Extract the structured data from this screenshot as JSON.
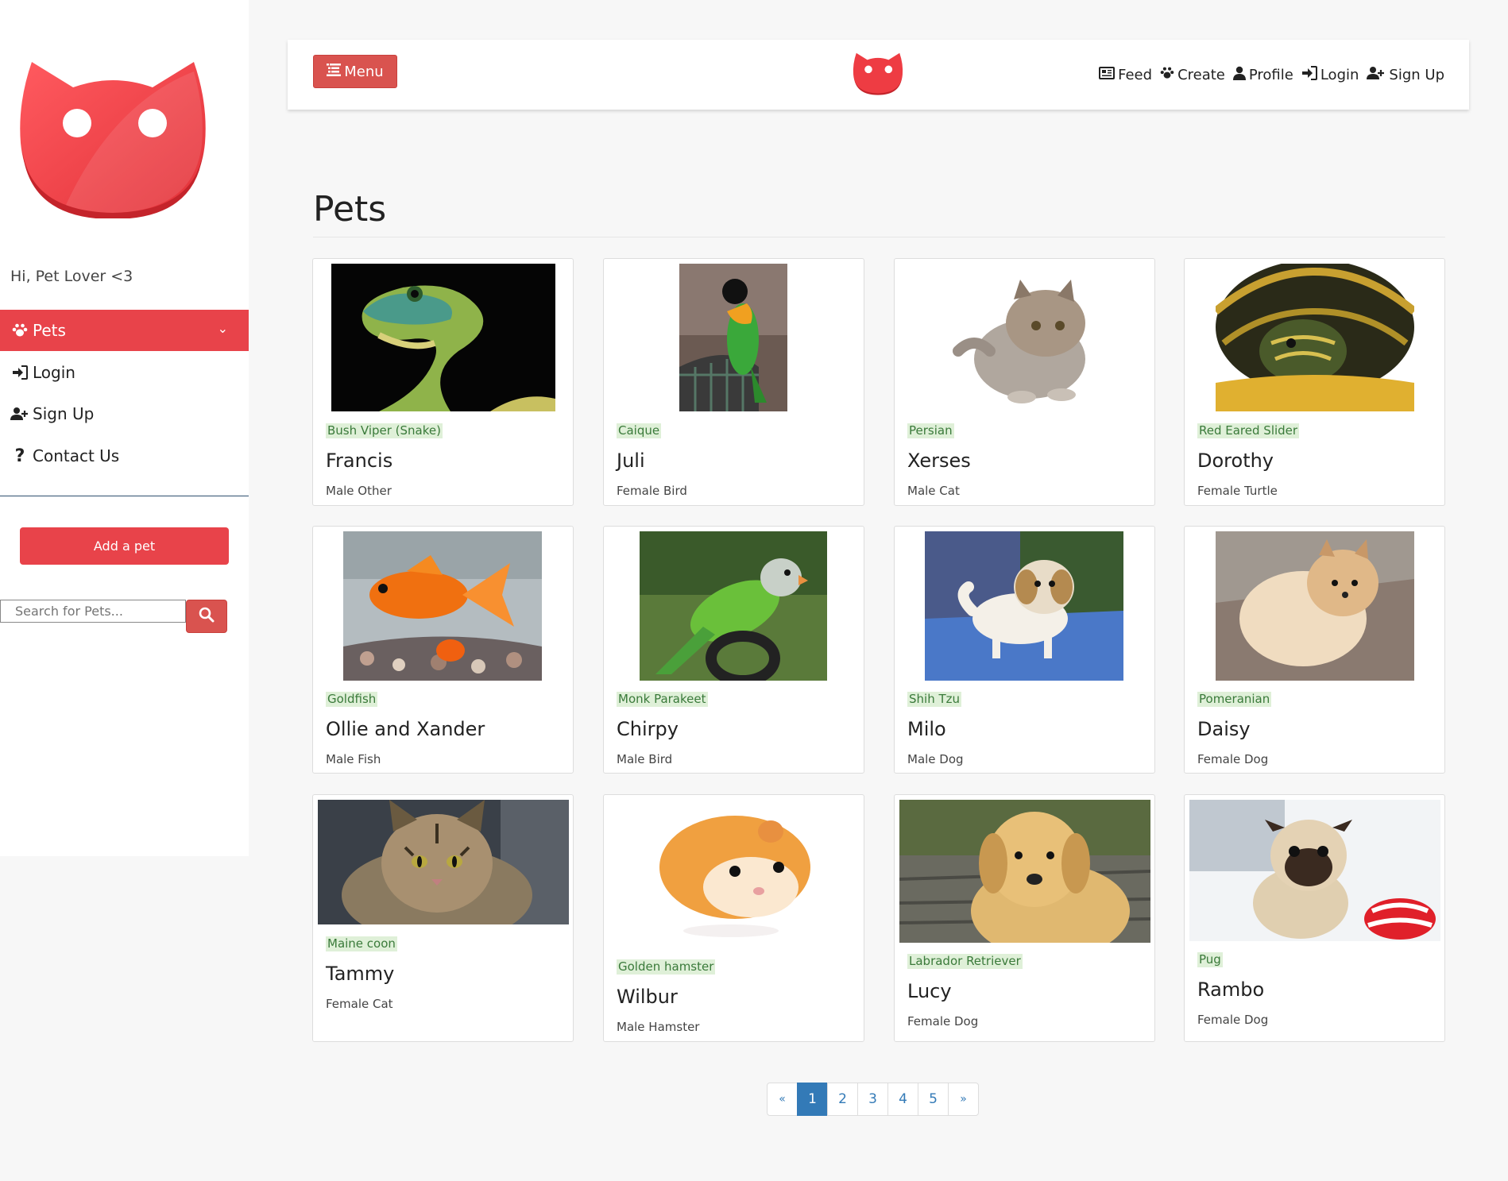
{
  "brand_color": "#e8434a",
  "sidebar": {
    "greeting": "Hi, Pet Lover <3",
    "nav": [
      {
        "label": "Pets",
        "icon": "paw-icon",
        "active": true
      },
      {
        "label": "Login",
        "icon": "login-icon"
      },
      {
        "label": "Sign Up",
        "icon": "user-plus-icon"
      },
      {
        "label": "Contact Us",
        "icon": "question-icon"
      }
    ],
    "add_pet_label": "Add a pet",
    "search_placeholder": "Search for Pets..."
  },
  "header": {
    "menu_label": "Menu",
    "links": [
      {
        "label": "Feed",
        "icon": "newspaper-icon"
      },
      {
        "label": "Create",
        "icon": "paw-icon"
      },
      {
        "label": "Profile",
        "icon": "user-icon"
      },
      {
        "label": "Login",
        "icon": "login-icon"
      },
      {
        "label": "Sign Up",
        "icon": "user-plus-icon"
      }
    ]
  },
  "page_title": "Pets",
  "pets": [
    {
      "breed": "Bush Viper (Snake)",
      "name": "Francis",
      "meta": "Male Other",
      "image": "snake"
    },
    {
      "breed": "Caique",
      "name": "Juli",
      "meta": "Female Bird",
      "image": "parrot"
    },
    {
      "breed": "Persian",
      "name": "Xerses",
      "meta": "Male Cat",
      "image": "persian-kitten"
    },
    {
      "breed": "Red Eared Slider",
      "name": "Dorothy",
      "meta": "Female Turtle",
      "image": "turtle"
    },
    {
      "breed": "Goldfish",
      "name": "Ollie and Xander",
      "meta": "Male Fish",
      "image": "goldfish"
    },
    {
      "breed": "Monk Parakeet",
      "name": "Chirpy",
      "meta": "Male Bird",
      "image": "parakeet"
    },
    {
      "breed": "Shih Tzu",
      "name": "Milo",
      "meta": "Male Dog",
      "image": "shih-tzu"
    },
    {
      "breed": "Pomeranian",
      "name": "Daisy",
      "meta": "Female Dog",
      "image": "pomeranian"
    },
    {
      "breed": "Maine coon",
      "name": "Tammy",
      "meta": "Female Cat",
      "image": "maine-coon"
    },
    {
      "breed": "Golden hamster",
      "name": "Wilbur",
      "meta": "Male Hamster",
      "image": "hamster"
    },
    {
      "breed": "Labrador Retriever",
      "name": "Lucy",
      "meta": "Female Dog",
      "image": "labrador"
    },
    {
      "breed": "Pug",
      "name": "Rambo",
      "meta": "Female Dog",
      "image": "pug"
    }
  ],
  "pagination": {
    "prev": "«",
    "pages": [
      "1",
      "2",
      "3",
      "4",
      "5"
    ],
    "current": "1",
    "next": "»"
  }
}
